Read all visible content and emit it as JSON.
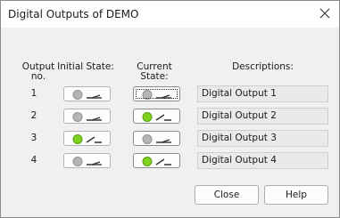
{
  "window": {
    "title": "Digital Outputs of DEMO"
  },
  "headers": {
    "output_no": [
      "Output",
      "no."
    ],
    "initial_state": "Initial State:",
    "current_state": [
      "Current",
      "State:"
    ],
    "descriptions": "Descriptions:"
  },
  "outputs": [
    {
      "no": "1",
      "initial_on": false,
      "current_on": false,
      "description": "Digital Output 1"
    },
    {
      "no": "2",
      "initial_on": false,
      "current_on": true,
      "description": "Digital Output 2"
    },
    {
      "no": "3",
      "initial_on": true,
      "current_on": false,
      "description": "Digital Output 3"
    },
    {
      "no": "4",
      "initial_on": false,
      "current_on": true,
      "description": "Digital Output 4"
    }
  ],
  "buttons": {
    "close": "Close",
    "help": "Help"
  },
  "icons": {
    "close": "close-icon",
    "switch": "toggle-switch-icon"
  },
  "colors": {
    "on": "#7ed321",
    "off": "#b5b5b5"
  }
}
